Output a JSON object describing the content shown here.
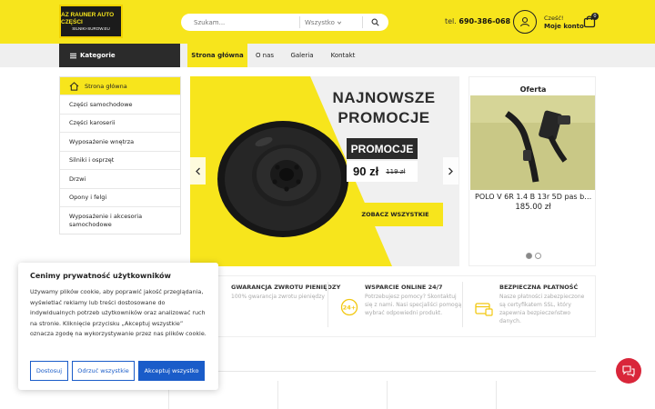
{
  "header": {
    "logo_line1": "AZ RAUNER AUTO CZĘŚCI",
    "logo_line2": "SILNIKI-SUROW.EU",
    "search": {
      "placeholder": "Szukam...",
      "category": "Wszystko"
    },
    "phone_label": "tel.",
    "phone_number": "690-386-068",
    "account_greeting": "Cześć!",
    "account_label": "Moje konto",
    "cart_count": "0"
  },
  "nav": {
    "categories_label": "Kategorie",
    "items": [
      {
        "label": "Strona główna"
      },
      {
        "label": "O nas"
      },
      {
        "label": "Galeria"
      },
      {
        "label": "Kontakt"
      }
    ]
  },
  "sidebar": {
    "items": [
      {
        "label": "Strona główna"
      },
      {
        "label": "Części samochodowe"
      },
      {
        "label": "Części karoserii"
      },
      {
        "label": "Wyposażenie wnętrza"
      },
      {
        "label": "Silniki i osprzęt"
      },
      {
        "label": "Drzwi"
      },
      {
        "label": "Opony i felgi"
      },
      {
        "label": "Wyposażenie i akcesoria samochodowe"
      }
    ]
  },
  "hero": {
    "title_line1": "NAJNOWSZE",
    "title_line2": "PROMOCJE",
    "promo_label": "PROMOCJE",
    "price_new": "90 zł",
    "price_old": "119 zł",
    "button_label": "ZOBACZ WSZYSTKIE"
  },
  "offer": {
    "title": "Oferta",
    "product_name": "POLO V 6R 1.4 B 13r 5D pas bezpieczeństwa",
    "product_price": "185.00 zł",
    "slide_index": 1,
    "slide_count": 2
  },
  "features": [
    {
      "title": "GWARANCJA ZWROTU PIENIĘDZY",
      "desc": "100% gwarancja zwrotu pieniędzy"
    },
    {
      "title": "WSPARCIE ONLINE 24/7",
      "desc": "Potrzebujesz pomocy? Skontaktuj się z nami. Nasi specjaliści pomogą wybrać odpowiedni produkt.",
      "icon_text": "24+"
    },
    {
      "title": "BEZPIECZNA PŁATNOŚĆ",
      "desc": "Nasze płatności zabezpieczone są certyfikatem SSL, który zapewnia bezpieczeństwo danych."
    }
  ],
  "cookie": {
    "title": "Cenimy prywatność użytkowników",
    "text": "Używamy plików cookie, aby poprawić jakość przeglądania, wyświetlać reklamy lub treści dostosowane do indywidualnych potrzeb użytkowników oraz analizować ruch na stronie. Kliknięcie przycisku „Akceptuj wszystkie” oznacza zgodę na wykorzystywanie przez nas plików cookie.",
    "btn_customize": "Dostosuj",
    "btn_reject": "Odrzuć wszystkie",
    "btn_accept": "Akceptuj wszystko"
  },
  "colors": {
    "brand_yellow": "#f7e51c",
    "dark": "#2b2b2b",
    "cookie_blue": "#1a5cc9",
    "chat_red": "#d9263a"
  }
}
